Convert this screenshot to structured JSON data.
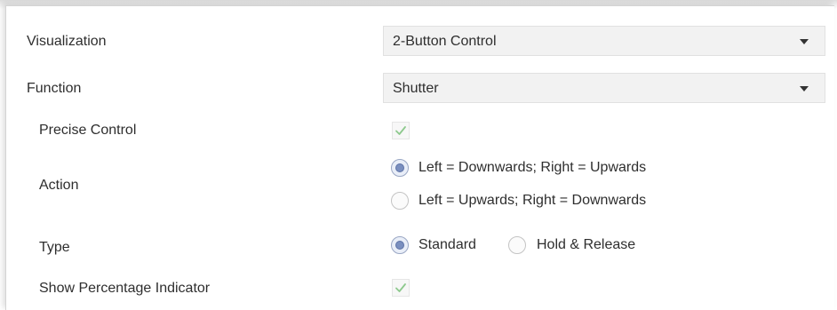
{
  "visualization": {
    "label": "Visualization",
    "value": "2-Button Control",
    "icon": "chevron-down-icon"
  },
  "function": {
    "label": "Function",
    "value": "Shutter",
    "icon": "chevron-down-icon"
  },
  "precise_control": {
    "label": "Precise Control",
    "checked": true
  },
  "action": {
    "label": "Action",
    "options": [
      {
        "label": "Left = Downwards; Right = Upwards",
        "selected": true
      },
      {
        "label": "Left = Upwards; Right = Downwards",
        "selected": false
      }
    ]
  },
  "type": {
    "label": "Type",
    "options": [
      {
        "label": "Standard",
        "selected": true
      },
      {
        "label": "Hold & Release",
        "selected": false
      }
    ]
  },
  "show_percentage_indicator": {
    "label": "Show Percentage Indicator",
    "checked": true
  },
  "colors": {
    "check": "#8dc98d",
    "radio_fill": "#7a8fbf",
    "select_bg": "#f2f2f2"
  }
}
